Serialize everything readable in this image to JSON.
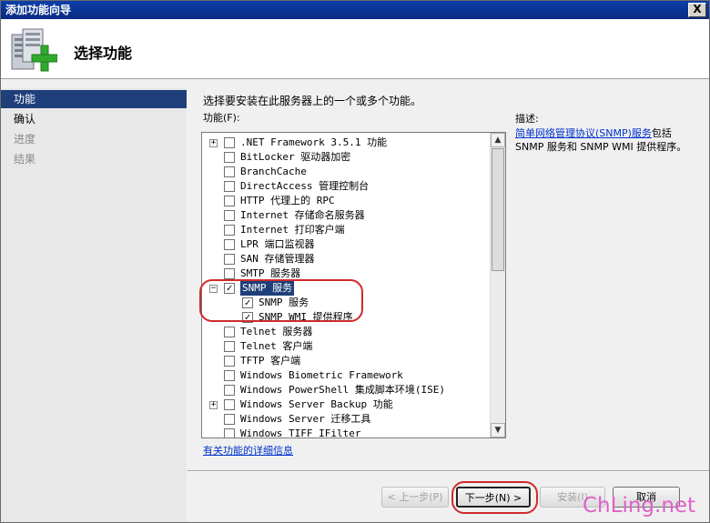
{
  "window": {
    "title": "添加功能向导",
    "close_label": "X"
  },
  "header": {
    "title": "选择功能"
  },
  "steps": [
    {
      "label": "功能",
      "state": "active"
    },
    {
      "label": "确认",
      "state": "normal"
    },
    {
      "label": "进度",
      "state": "disabled"
    },
    {
      "label": "结果",
      "state": "disabled"
    }
  ],
  "content": {
    "intro": "选择要安装在此服务器上的一个或多个功能。",
    "features_label": "功能(F):",
    "description_label": "描述:",
    "description_link": "简单网络管理协议(SNMP)服务",
    "description_text": "包括 SNMP 服务和 SNMP WMI 提供程序。",
    "more_info_link": "有关功能的详细信息"
  },
  "features": [
    {
      "label": ".NET Framework 3.5.1 功能",
      "checked": false,
      "expander": "+",
      "indent": 0
    },
    {
      "label": "BitLocker 驱动器加密",
      "checked": false,
      "expander": "",
      "indent": 0
    },
    {
      "label": "BranchCache",
      "checked": false,
      "expander": "",
      "indent": 0
    },
    {
      "label": "DirectAccess 管理控制台",
      "checked": false,
      "expander": "",
      "indent": 0
    },
    {
      "label": "HTTP 代理上的 RPC",
      "checked": false,
      "expander": "",
      "indent": 0
    },
    {
      "label": "Internet 存储命名服务器",
      "checked": false,
      "expander": "",
      "indent": 0
    },
    {
      "label": "Internet 打印客户端",
      "checked": false,
      "expander": "",
      "indent": 0
    },
    {
      "label": "LPR 端口监视器",
      "checked": false,
      "expander": "",
      "indent": 0
    },
    {
      "label": "SAN 存储管理器",
      "checked": false,
      "expander": "",
      "indent": 0
    },
    {
      "label": "SMTP 服务器",
      "checked": false,
      "expander": "",
      "indent": 0
    },
    {
      "label": "SNMP 服务",
      "checked": true,
      "expander": "−",
      "indent": 0,
      "selected": true
    },
    {
      "label": "SNMP 服务",
      "checked": true,
      "expander": "",
      "indent": 1
    },
    {
      "label": "SNMP WMI 提供程序",
      "checked": true,
      "expander": "",
      "indent": 1
    },
    {
      "label": "Telnet 服务器",
      "checked": false,
      "expander": "",
      "indent": 0
    },
    {
      "label": "Telnet 客户端",
      "checked": false,
      "expander": "",
      "indent": 0
    },
    {
      "label": "TFTP 客户端",
      "checked": false,
      "expander": "",
      "indent": 0
    },
    {
      "label": "Windows Biometric Framework",
      "checked": false,
      "expander": "",
      "indent": 0
    },
    {
      "label": "Windows PowerShell 集成脚本环境(ISE)",
      "checked": false,
      "expander": "",
      "indent": 0
    },
    {
      "label": "Windows Server Backup 功能",
      "checked": false,
      "expander": "+",
      "indent": 0
    },
    {
      "label": "Windows Server 迁移工具",
      "checked": false,
      "expander": "",
      "indent": 0
    },
    {
      "label": "Windows TIFF IFilter",
      "checked": false,
      "expander": "",
      "indent": 0
    }
  ],
  "buttons": {
    "previous": "< 上一步(P)",
    "next": "下一步(N) >",
    "install": "安装(I)",
    "cancel": "取消"
  },
  "watermark": "ChLing.net",
  "colors": {
    "accent": "#1f3f7a",
    "highlight": "#d02a2a",
    "link": "#0033cc",
    "watermark": "#e060c8"
  }
}
